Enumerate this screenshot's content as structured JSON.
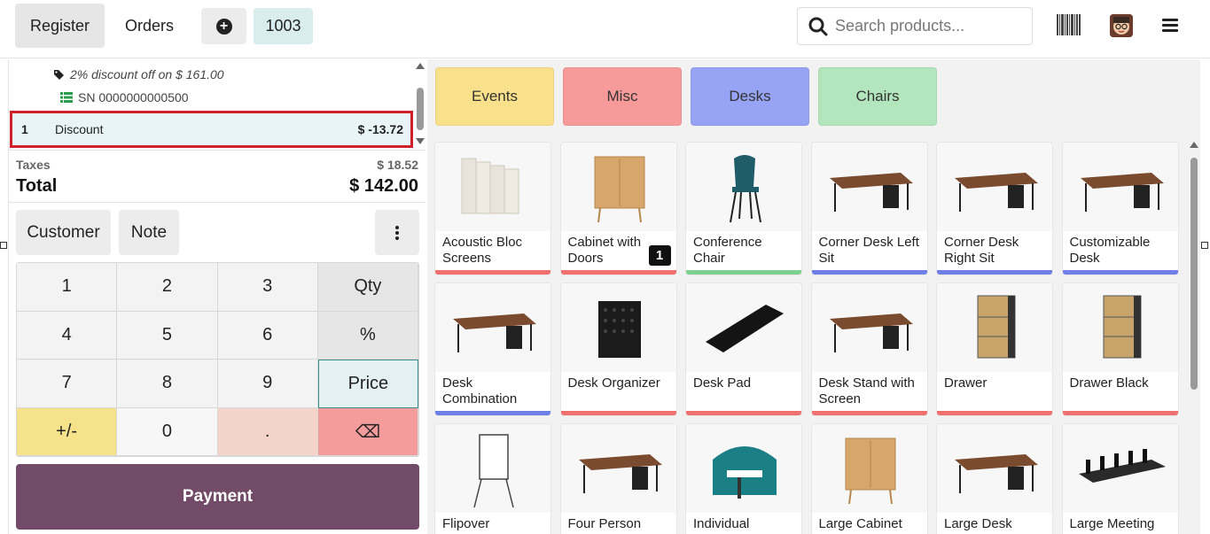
{
  "header": {
    "register_label": "Register",
    "orders_label": "Orders",
    "order_number": "1003",
    "search_placeholder": "Search products..."
  },
  "order": {
    "discount_info": "2% discount off on $ 161.00",
    "serial_number": "SN 0000000000500",
    "selected_line": {
      "qty": "1",
      "name": "Discount",
      "price": "$ -13.72"
    },
    "taxes_label": "Taxes",
    "taxes_value": "$ 18.52",
    "total_label": "Total",
    "total_value": "$ 142.00"
  },
  "actions": {
    "customer_label": "Customer",
    "note_label": "Note"
  },
  "numpad": {
    "keys": [
      "1",
      "2",
      "3",
      "Qty",
      "4",
      "5",
      "6",
      "%",
      "7",
      "8",
      "9",
      "Price",
      "+/-",
      "0",
      ".",
      "⌫"
    ],
    "active_mode": "Price"
  },
  "payment_label": "Payment",
  "categories": [
    {
      "label": "Events",
      "color": "#f9e08a"
    },
    {
      "label": "Misc",
      "color": "#f79a9a"
    },
    {
      "label": "Desks",
      "color": "#97a3f4"
    },
    {
      "label": "Chairs",
      "color": "#b3e6bd"
    }
  ],
  "products": [
    {
      "name": "Acoustic Bloc Screens",
      "color": "#f07070",
      "icon": "screen-icon"
    },
    {
      "name": "Cabinet with Doors",
      "color": "#f07070",
      "icon": "cabinet-icon",
      "qty_badge": "1"
    },
    {
      "name": "Conference Chair",
      "color": "#7ed08f",
      "icon": "chair-icon"
    },
    {
      "name": "Corner Desk Left Sit",
      "color": "#6f7fe8",
      "icon": "desk-icon"
    },
    {
      "name": "Corner Desk Right Sit",
      "color": "#6f7fe8",
      "icon": "desk-icon"
    },
    {
      "name": "Customizable Desk",
      "color": "#6f7fe8",
      "icon": "desk-icon"
    },
    {
      "name": "Desk Combination",
      "color": "#6f7fe8",
      "icon": "desk-icon"
    },
    {
      "name": "Desk Organizer",
      "color": "#f07070",
      "icon": "organizer-icon"
    },
    {
      "name": "Desk Pad",
      "color": "#f07070",
      "icon": "pad-icon"
    },
    {
      "name": "Desk Stand with Screen",
      "color": "#f07070",
      "icon": "desk-icon"
    },
    {
      "name": "Drawer",
      "color": "#f07070",
      "icon": "drawer-icon"
    },
    {
      "name": "Drawer Black",
      "color": "#f07070",
      "icon": "drawer-icon"
    },
    {
      "name": "Flipover",
      "color": "#f07070",
      "icon": "flipchart-icon"
    },
    {
      "name": "Four Person",
      "color": "#6f7fe8",
      "icon": "desk-icon"
    },
    {
      "name": "Individual",
      "color": "#f07070",
      "icon": "booth-icon"
    },
    {
      "name": "Large Cabinet",
      "color": "#f07070",
      "icon": "cabinet-icon"
    },
    {
      "name": "Large Desk",
      "color": "#6f7fe8",
      "icon": "desk-icon"
    },
    {
      "name": "Large Meeting",
      "color": "#6f7fe8",
      "icon": "table-icon"
    }
  ]
}
